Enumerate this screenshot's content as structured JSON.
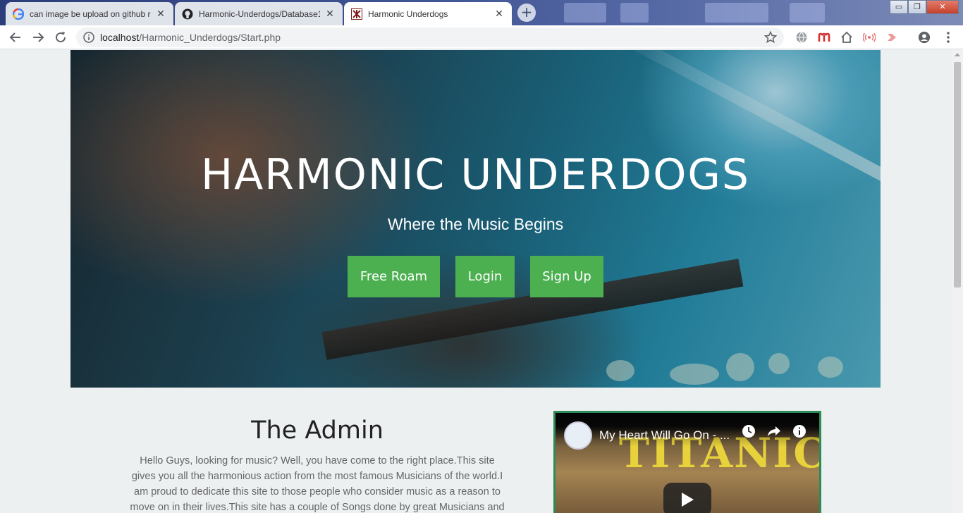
{
  "browser": {
    "tabs": [
      {
        "title": "can image be upload on github r",
        "favicon": "google-icon",
        "active": false
      },
      {
        "title": "Harmonic-Underdogs/Database1",
        "favicon": "github-icon",
        "active": false
      },
      {
        "title": "Harmonic Underdogs",
        "favicon": "site-icon",
        "active": true
      }
    ],
    "new_tab": "+",
    "window_controls": {
      "minimize": "▭",
      "restore": "❐",
      "close": "✕"
    },
    "url_host": "localhost",
    "url_path": "/Harmonic_Underdogs/Start.php"
  },
  "hero": {
    "title": "HARMONIC UNDERDOGS",
    "subtitle": "Where the Music Begins",
    "buttons": {
      "free_roam": "Free Roam",
      "login": "Login",
      "sign_up": "Sign Up"
    }
  },
  "admin": {
    "title": "The Admin",
    "text": "Hello Guys, looking for music? Well, you have come to the right place.This site gives you all the harmonious action from the most famous Musicians of the world.I am proud to dedicate this site to those people who consider music as a reason to move on in their lives.This site has a couple of Songs done by great Musicians and"
  },
  "video": {
    "title": "My Heart Will Go On - ...",
    "background_text": "TITANIC"
  },
  "colors": {
    "accent_button": "#4caf50",
    "video_border": "#2e8b57",
    "page_bg": "#ecf0f1"
  }
}
